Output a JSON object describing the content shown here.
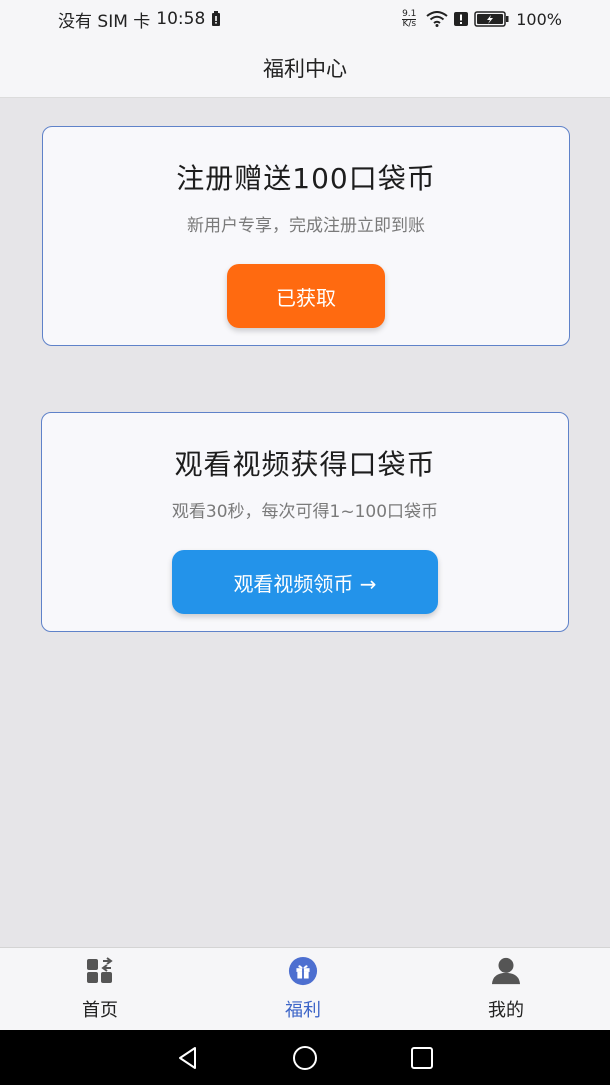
{
  "status_bar": {
    "carrier": "没有 SIM 卡",
    "time": "10:58",
    "net_speed_value": "9.1",
    "net_speed_unit": "K/s",
    "battery": "100%"
  },
  "header": {
    "title": "福利中心"
  },
  "cards": [
    {
      "title": "注册赠送100口袋币",
      "subtitle": "新用户专享，完成注册立即到账",
      "button_label": "已获取"
    },
    {
      "title": "观看视频获得口袋币",
      "subtitle": "观看30秒，每次可得1~100口袋币",
      "button_label": "观看视频领币 →"
    }
  ],
  "tabs": [
    {
      "label": "首页",
      "icon": "home-grid-icon"
    },
    {
      "label": "福利",
      "icon": "gift-icon",
      "active": true
    },
    {
      "label": "我的",
      "icon": "user-icon"
    }
  ],
  "colors": {
    "accent": "#3d65c8",
    "claimed_button": "#ff6a10",
    "watch_button": "#2393ea",
    "card_border": "#5f82c9"
  }
}
